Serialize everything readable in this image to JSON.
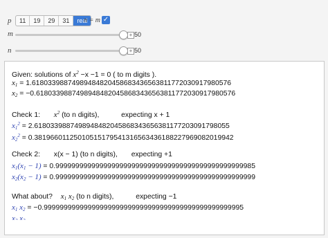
{
  "controls": {
    "p_label": "p",
    "p_options": [
      "11",
      "19",
      "29",
      "31",
      "real"
    ],
    "p_selected_index": 4,
    "neq_label": "n = m",
    "neq_checked": true,
    "m_label": "m",
    "m_value": "50",
    "n_label": "n",
    "n_value": "50",
    "accent_color": "#3a7ad6"
  },
  "output": {
    "given_prefix": "Given: solutions of",
    "given_equation_tail": "−x −1 = 0 ( to m digits ).",
    "x1_value": "1.61803398874989484820458683436563811772030917980576",
    "x2_value": "−0.61803398874989484820458683436563811772030917980576",
    "check1": {
      "label": "Check 1:",
      "expr_tail": "(to n digits),",
      "expecting": "expecting x + 1",
      "r1_value": "= 2.6180339887498948482045868343656381177203091798055",
      "r2_value": "= 0.38196601125010515179541316563436188227969082019942"
    },
    "check2": {
      "label": "Check 2:",
      "expr": "x(x − 1) (to n digits),",
      "expecting": "expecting +1",
      "r1_value": "= 0.99999999999999999999999999999999999999999999999985",
      "r2_value": "= 0.99999999999999999999999999999999999999999999999999"
    },
    "what_about": {
      "label": "What about?",
      "expr_tail": "(to n digits),",
      "expecting": "expecting −1",
      "r1_value": "= −0.99999999999999999999999999999999999999999999999995"
    }
  }
}
